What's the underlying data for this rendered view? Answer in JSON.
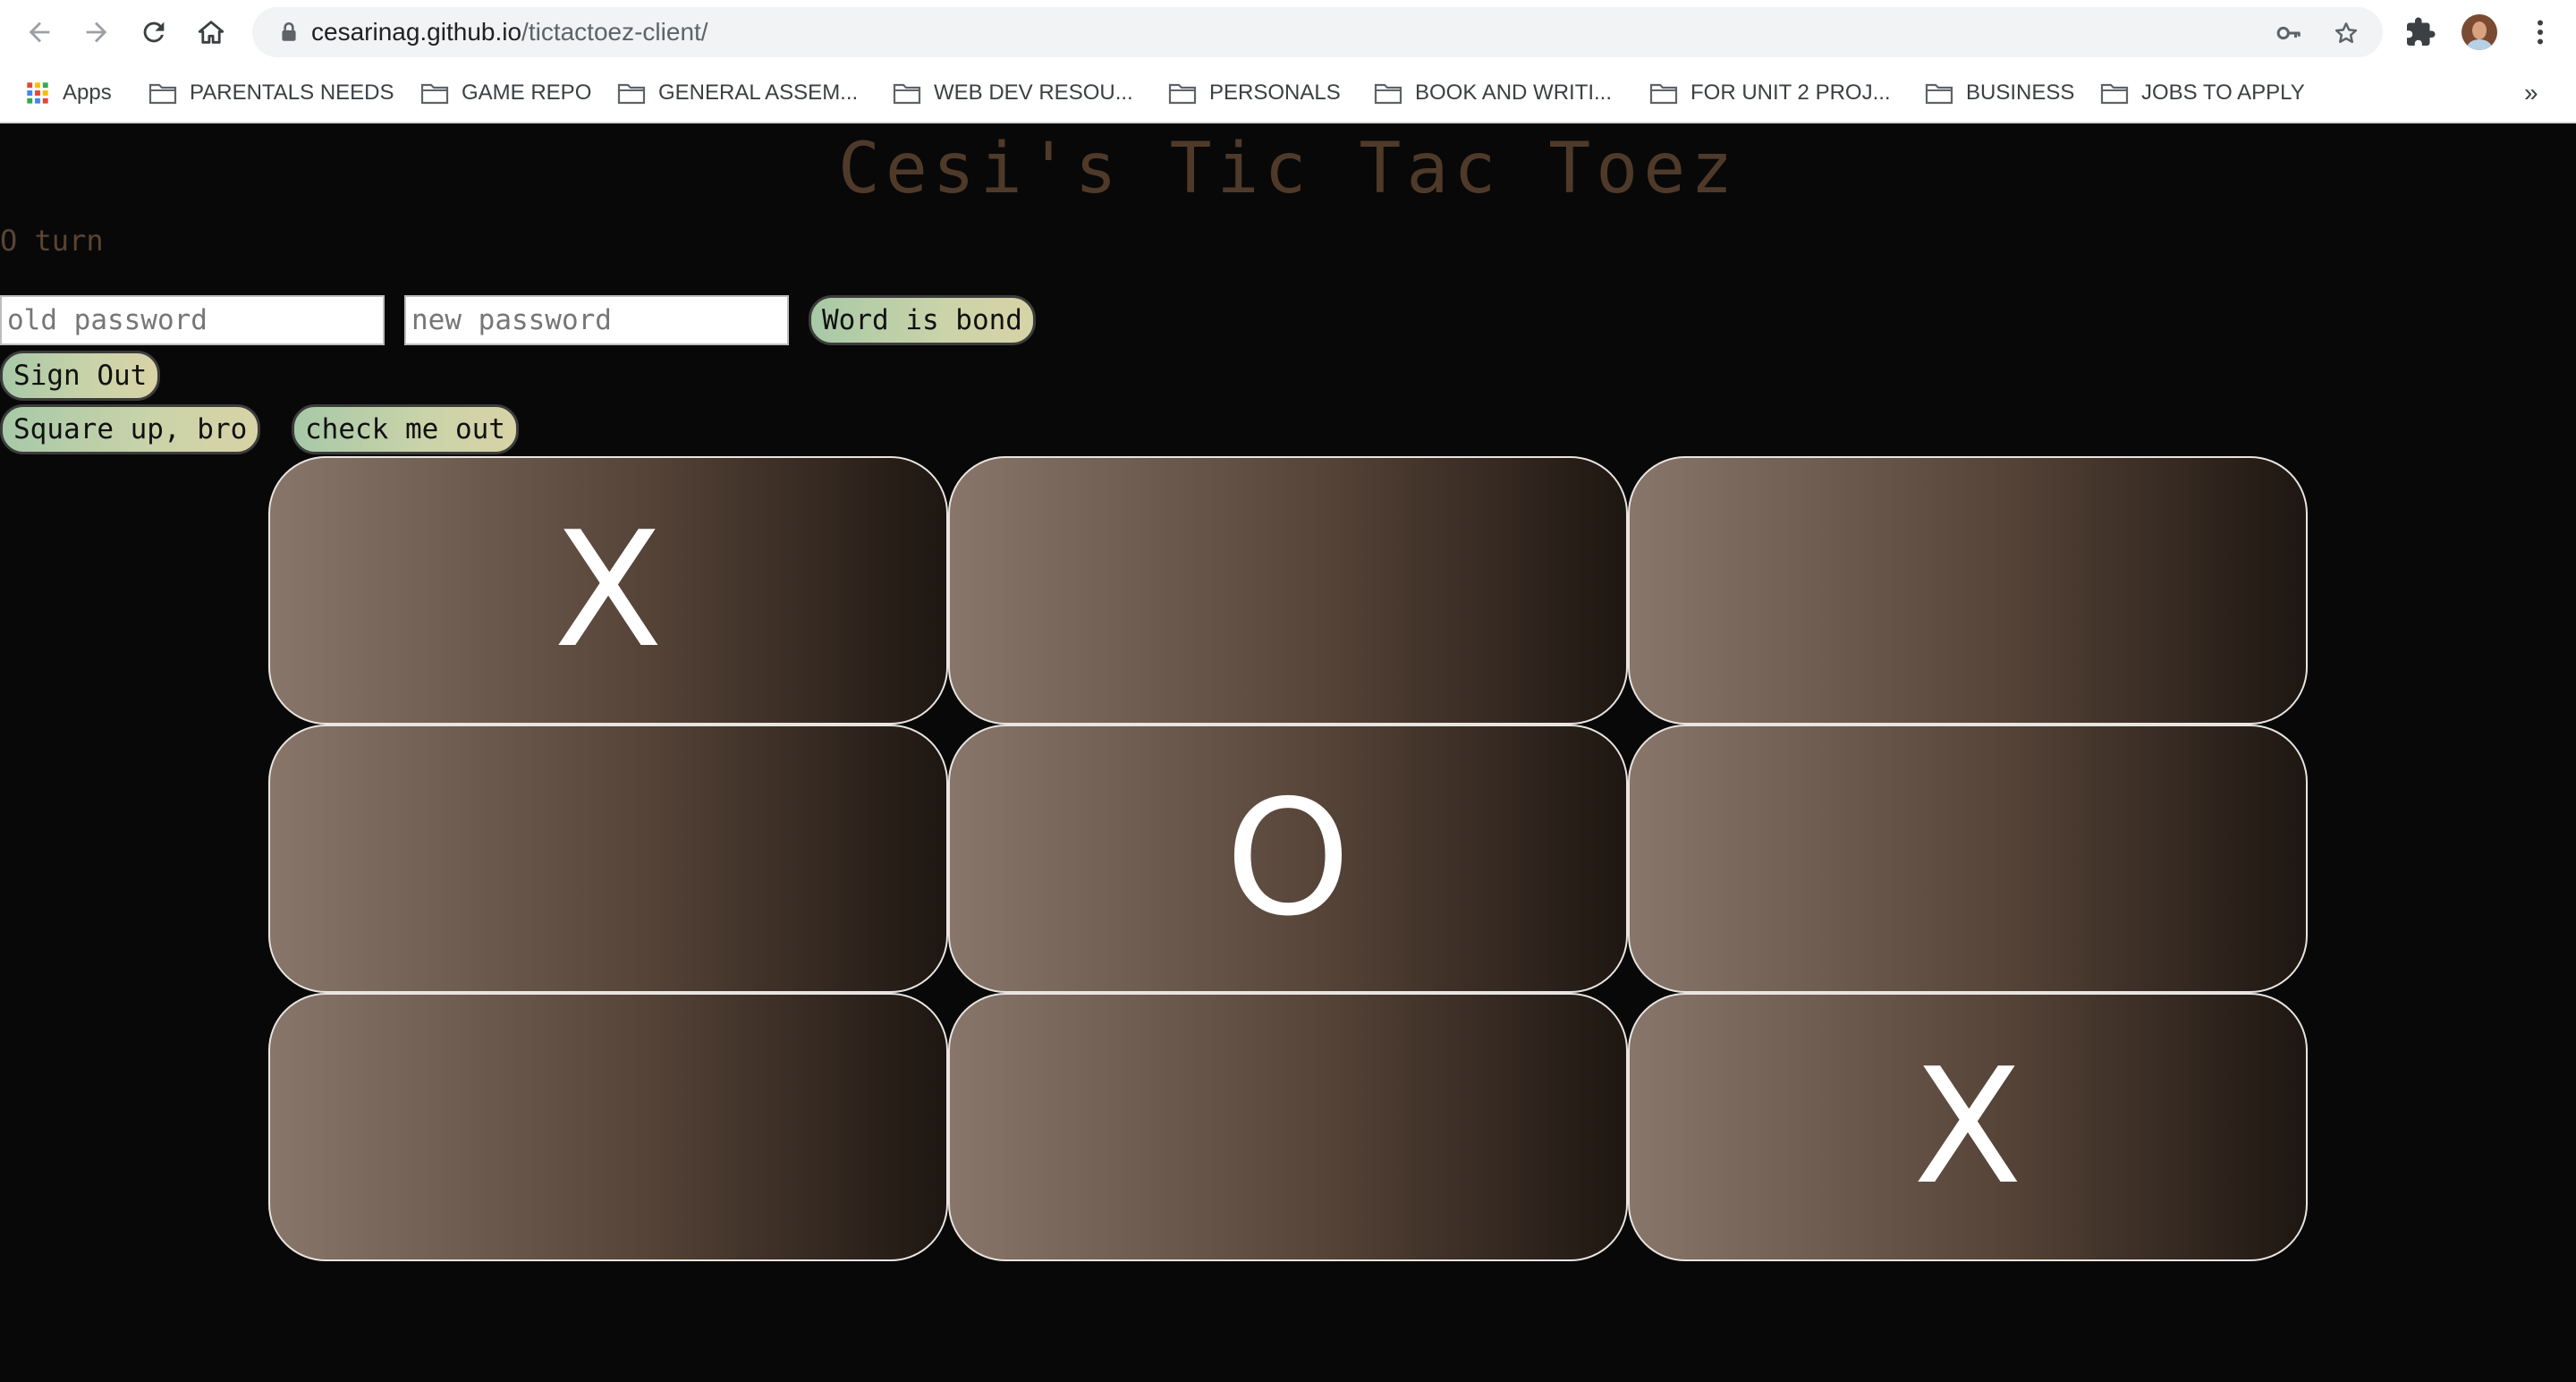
{
  "browser": {
    "url_host": "cesarinag.github.io",
    "url_path": "/tictactoez-client/",
    "bookmarks": [
      "Apps",
      "PARENTALS NEEDS",
      "GAME REPO",
      "GENERAL ASSEM...",
      "WEB DEV RESOU...",
      "PERSONALS",
      "BOOK AND WRITI...",
      "FOR UNIT 2 PROJ...",
      "BUSINESS",
      "JOBS TO APPLY"
    ],
    "more": "»"
  },
  "page": {
    "title": "Cesi's Tic Tac Toez",
    "turn_message": "O turn",
    "old_password_placeholder": "old password",
    "new_password_placeholder": "new password",
    "change_password_button": "Word is bond",
    "sign_out_button": "Sign Out",
    "new_game_button": "Square up, bro",
    "stats_button": "check me out"
  },
  "board": {
    "cells": [
      "X",
      "",
      "",
      "",
      "O",
      "",
      "",
      "",
      "X"
    ]
  },
  "colors": {
    "background": "#080808",
    "title": "#4f3a2a",
    "cell_gradient_start": "#88766b",
    "cell_gradient_end": "#1e1611",
    "cell_border": "#e9e4df",
    "button_gradient_start": "#a7c9a7",
    "button_gradient_end": "#d7d3a6"
  },
  "icons": [
    "back-arrow-icon",
    "forward-arrow-icon",
    "reload-icon",
    "home-icon",
    "lock-icon",
    "key-icon",
    "star-icon",
    "extensions-puzzle-icon",
    "profile-avatar",
    "menu-dots-icon",
    "apps-grid-icon",
    "folder-icon"
  ]
}
